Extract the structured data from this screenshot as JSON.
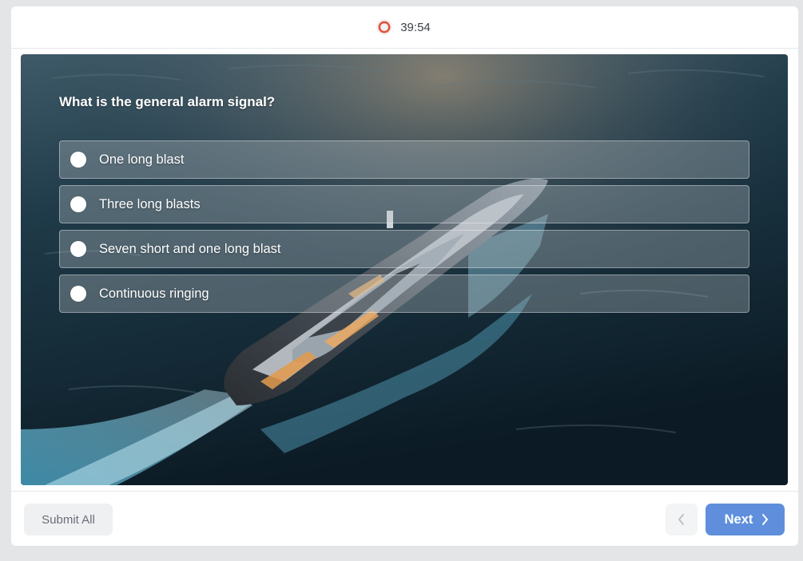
{
  "header": {
    "timer_text": "39:54",
    "timer_icon": "record-icon",
    "timer_color": "#e5533d"
  },
  "quiz": {
    "question": "What is the general alarm signal?",
    "options": [
      {
        "label": "One long blast",
        "selected": false
      },
      {
        "label": "Three long blasts",
        "selected": false
      },
      {
        "label": "Seven short and one long blast",
        "selected": false
      },
      {
        "label": "Continuous ringing",
        "selected": false
      }
    ],
    "background_image": "yacht-at-sea"
  },
  "footer": {
    "submit_label": "Submit All",
    "prev_icon": "chevron-left-icon",
    "next_label": "Next",
    "next_icon": "chevron-right-icon",
    "accent_color": "#5f8fdc"
  }
}
